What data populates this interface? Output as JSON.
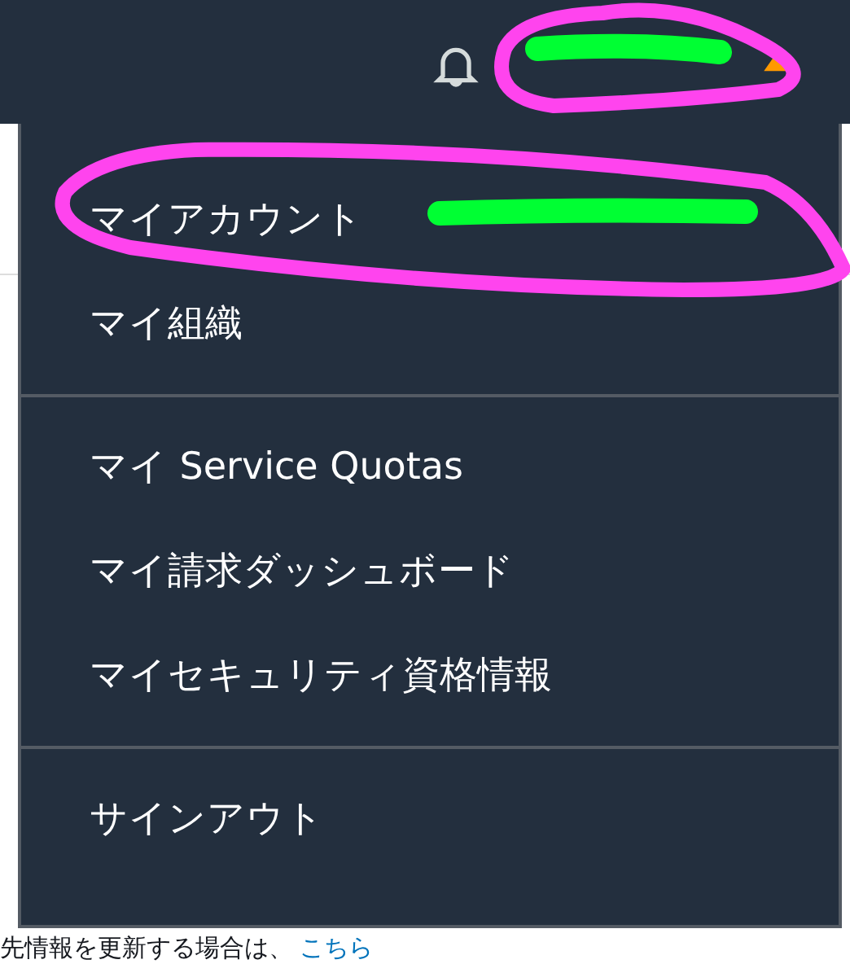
{
  "menu": {
    "sections": [
      {
        "items": [
          {
            "label": "マイアカウント"
          },
          {
            "label": "マイ組織"
          }
        ]
      },
      {
        "items": [
          {
            "label": "マイ Service Quotas"
          },
          {
            "label": "マイ請求ダッシュボード"
          },
          {
            "label": "マイセキュリティ資格情報"
          }
        ]
      },
      {
        "items": [
          {
            "label": "サインアウト"
          }
        ]
      }
    ]
  },
  "background_text": {
    "text": "先情報を更新する場合は、",
    "link": "こちら"
  }
}
